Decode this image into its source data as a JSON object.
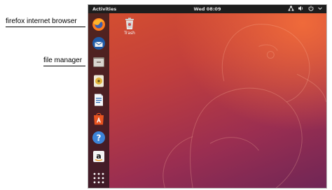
{
  "annotations": {
    "firefox": "firefox internet browser",
    "file_manager": "file manager"
  },
  "topbar": {
    "activities": "Activities",
    "clock": "Wed 08:09",
    "tray_icons": [
      "network-icon",
      "volume-icon",
      "power-icon",
      "chevron-down-icon"
    ]
  },
  "desktop_icons": [
    {
      "name": "trash-icon",
      "label": "Trash"
    }
  ],
  "dock": {
    "items": [
      "firefox-icon",
      "thunderbird-icon",
      "files-icon",
      "rhythmbox-icon",
      "libreoffice-writer-icon",
      "ubuntu-software-icon",
      "help-icon",
      "amazon-icon",
      "show-applications-icon"
    ]
  },
  "colors": {
    "wallpaper_top": "#d7512e",
    "wallpaper_bottom": "#6f2656",
    "topbar": "#1d1d1d",
    "dock": "#1e1419"
  }
}
